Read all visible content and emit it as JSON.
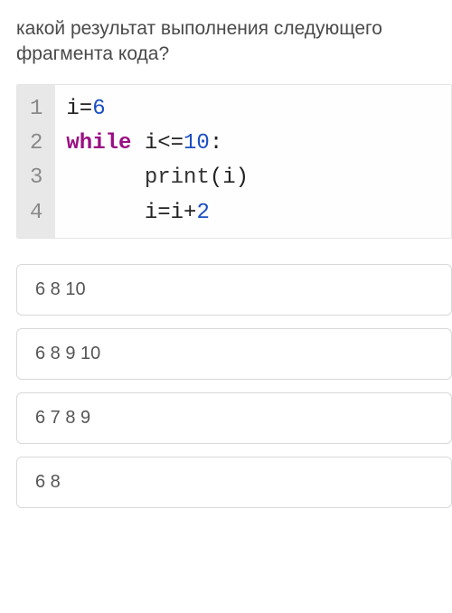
{
  "question": "какой результат выполнения следующего фрагмента кода?",
  "code": {
    "line_numbers": [
      "1",
      "2",
      "3",
      "4"
    ],
    "lines": [
      {
        "segments": [
          {
            "t": "i=",
            "c": "plain"
          },
          {
            "t": "6",
            "c": "num"
          }
        ]
      },
      {
        "segments": [
          {
            "t": "while",
            "c": "kw"
          },
          {
            "t": " i<=",
            "c": "plain"
          },
          {
            "t": "10",
            "c": "num"
          },
          {
            "t": ":",
            "c": "plain"
          }
        ]
      },
      {
        "segments": [
          {
            "t": "      ",
            "c": "plain"
          },
          {
            "t": "print",
            "c": "fn"
          },
          {
            "t": "(i)",
            "c": "plain"
          }
        ]
      },
      {
        "segments": [
          {
            "t": "      i=i+",
            "c": "plain"
          },
          {
            "t": "2",
            "c": "num"
          }
        ]
      }
    ]
  },
  "answers": [
    "6 8 10",
    "6 8 9 10",
    "6 7 8 9",
    "6 8"
  ]
}
